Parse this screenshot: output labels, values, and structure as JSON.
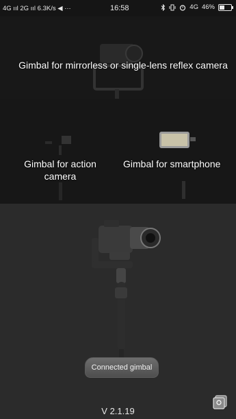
{
  "status_bar": {
    "left_text": "4G ııl 2G ııl 6.3K/s ◀ ···",
    "time": "16:58",
    "right_text": "4G",
    "battery": "46%",
    "battery_level": 0.46
  },
  "gimbals": {
    "mirrorless_label": "Gimbal for mirrorless or single-lens reflex camera",
    "action_label": "Gimbal for action camera",
    "smartphone_label": "Gimbal for smartphone"
  },
  "connected_button": "Connected gimbal",
  "version": "V 2.1.19",
  "icons": {
    "bluetooth": "bluetooth-icon",
    "vibrate": "vibrate-icon",
    "alarm": "alarm-icon",
    "battery": "battery-icon",
    "album": "album-icon"
  },
  "colors": {
    "background_dark": "#181818",
    "background_bottom": "#2b2b2b",
    "button": "#5e5e5e",
    "text": "#ffffff"
  }
}
